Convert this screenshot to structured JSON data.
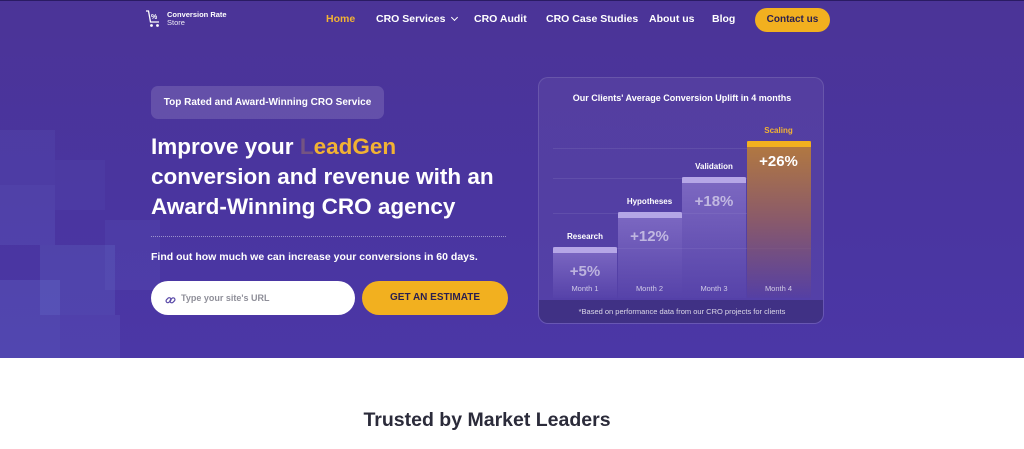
{
  "brand": {
    "logo_line1": "Conversion Rate",
    "logo_line2": "Store",
    "icon": "cart-percent-icon"
  },
  "nav": {
    "items": [
      {
        "label": "Home",
        "active": true
      },
      {
        "label": "CRO Services",
        "dropdown": true
      },
      {
        "label": "CRO Audit"
      },
      {
        "label": "CRO Case Studies"
      },
      {
        "label": "About us"
      },
      {
        "label": "Blog"
      }
    ],
    "cta": "Contact us"
  },
  "hero": {
    "badge": "Top Rated and Award-Winning CRO Service",
    "headline_prefix": "Improve your",
    "headline_fade": "L",
    "headline_accent": "eadGen",
    "headline_line2": "conversion and revenue with an",
    "headline_line3": "Award-Winning CRO agency",
    "subtext": "Find out how much we can increase your conversions in 60 days.",
    "url_placeholder": "Type your site's URL",
    "estimate_button": "GET AN ESTIMATE"
  },
  "chart_data": {
    "type": "bar",
    "title": "Our Clients' Average Conversion Uplift in 4 months",
    "categories": [
      "Month 1",
      "Month 2",
      "Month 3",
      "Month 4"
    ],
    "stages": [
      "Research",
      "Hypotheses",
      "Validation",
      "Scaling"
    ],
    "values": [
      5,
      12,
      18,
      26
    ],
    "value_labels": [
      "+5%",
      "+12%",
      "+18%",
      "+26%"
    ],
    "unit": "%",
    "footnote": "*Based on performance data from our CRO projects for clients",
    "colors": {
      "bar": "#b5a6e6",
      "highlight": "#f2b01f"
    }
  },
  "trusted": {
    "heading": "Trusted by Market Leaders"
  },
  "colors": {
    "hero_bg": "#4a35a0",
    "accent": "#f2b01f",
    "dark_text": "#2b2b3a"
  }
}
